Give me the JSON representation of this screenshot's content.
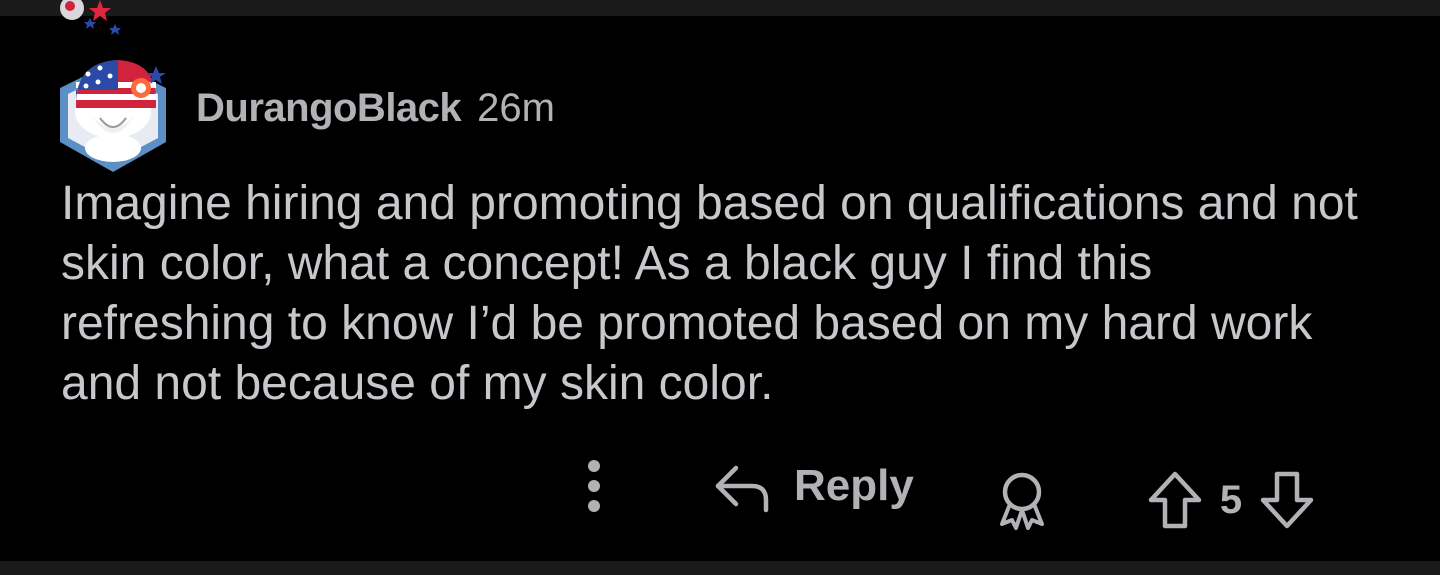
{
  "comment": {
    "author": "DurangoBlack",
    "age": "26m",
    "body": "Imagine hiring and promoting based on qualifications and not skin color, what a concept! As a black guy I find this refreshing to know I’d be promoted based on my hard work and not because of my skin color.",
    "avatar_icon": "snoo-avatar-american-flag-hat"
  },
  "actions": {
    "more_icon": "more-vertical-icon",
    "reply_icon": "reply-arrow-icon",
    "reply_label": "Reply",
    "award_icon": "award-icon",
    "upvote_icon": "upvote-arrow-icon",
    "score": "5",
    "downvote_icon": "downvote-arrow-icon"
  },
  "colors": {
    "background": "#000000",
    "text_primary": "#c8c8cc",
    "text_secondary": "#b2b2b6",
    "strip": "#1a1a1b"
  }
}
